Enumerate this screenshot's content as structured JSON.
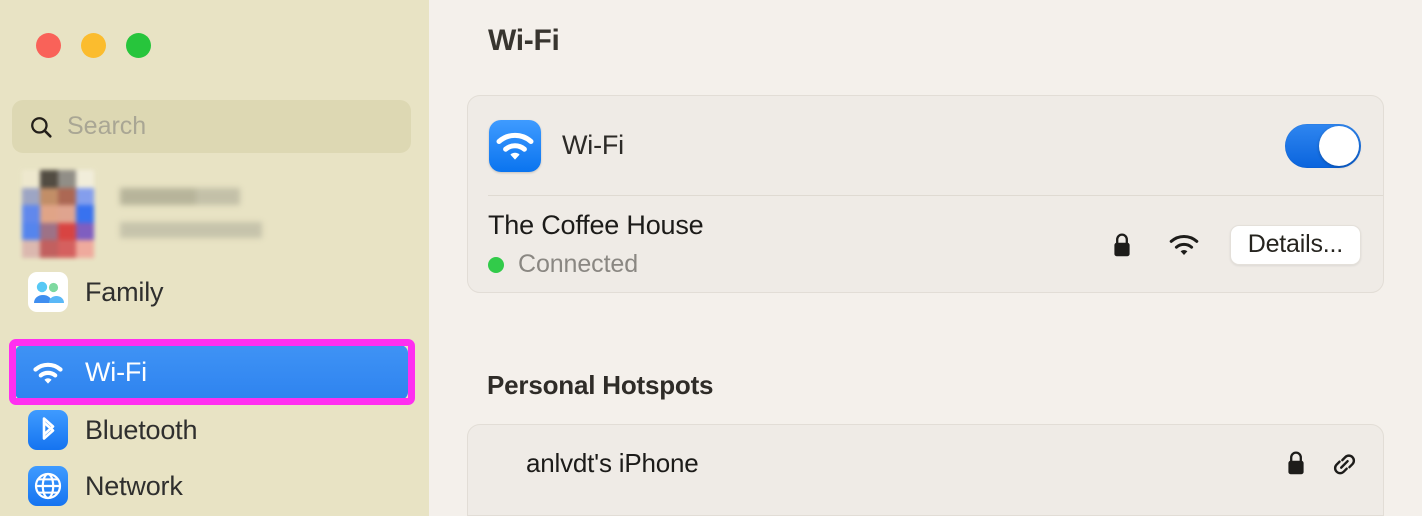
{
  "window": {
    "traffic_lights": [
      {
        "name": "close",
        "color": "#f96259"
      },
      {
        "name": "minimize",
        "color": "#fbbc2e"
      },
      {
        "name": "zoom",
        "color": "#27c53c"
      }
    ]
  },
  "sidebar": {
    "search": {
      "placeholder": "Search",
      "value": "",
      "icon": "search-icon"
    },
    "account": {
      "name_redacted": true,
      "subtitle_redacted": true
    },
    "items": [
      {
        "label": "Family",
        "icon": "family-icon",
        "selected": false
      },
      {
        "label": "Wi-Fi",
        "icon": "wifi-icon",
        "selected": true
      },
      {
        "label": "Bluetooth",
        "icon": "bluetooth-icon",
        "selected": false
      },
      {
        "label": "Network",
        "icon": "globe-icon",
        "selected": false
      }
    ]
  },
  "main": {
    "title": "Wi-Fi",
    "wifi_card": {
      "toggle_row": {
        "label": "Wi-Fi",
        "icon": "wifi-app-icon",
        "toggle_on": true
      },
      "network": {
        "name": "The Coffee House",
        "status": "Connected",
        "status_color": "#32cb4a",
        "secured_icon": "lock-icon",
        "signal_icon": "wifi-signal-icon",
        "details_label": "Details..."
      }
    },
    "hotspots": {
      "heading": "Personal Hotspots",
      "items": [
        {
          "name": "anlvdt's iPhone",
          "secured_icon": "lock-icon",
          "link_icon": "link-icon"
        }
      ]
    }
  },
  "annotation": {
    "highlight_color": "#ff2ff0",
    "target": "Wi-Fi"
  }
}
